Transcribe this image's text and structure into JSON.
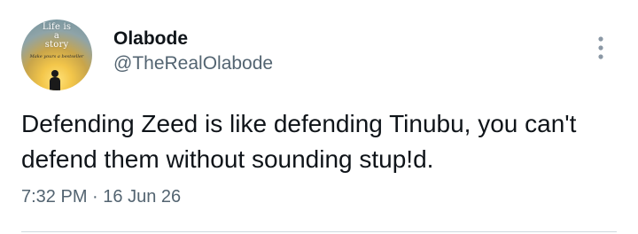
{
  "author": {
    "display_name": "Olabode",
    "handle": "@TheRealOlabode",
    "avatar": {
      "icon": "profile-avatar-image",
      "text": "Life is\na\nstory",
      "subtext": "Make yours a bestseller"
    }
  },
  "tweet": {
    "text": "Defending Zeed is like defending Tinubu, you can't defend them without sounding stup!d.",
    "time": "7:32 PM",
    "separator": "·",
    "date": "16 Jun 26"
  },
  "menu": {
    "icon": "more-vertical-icon"
  },
  "colors": {
    "text_primary": "#0f1419",
    "text_secondary": "#536471",
    "divider": "#cfd9de",
    "background": "#ffffff"
  }
}
